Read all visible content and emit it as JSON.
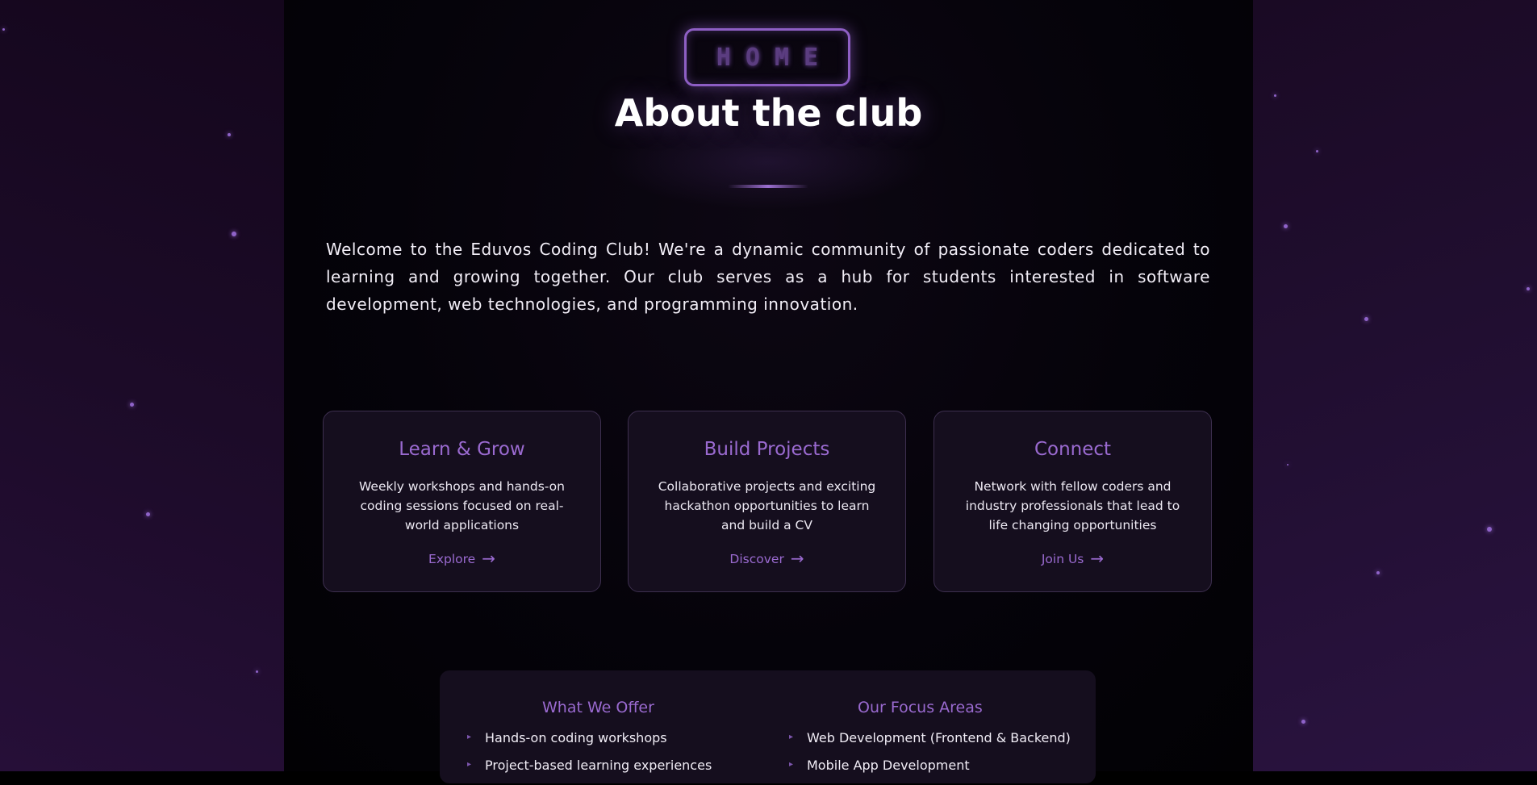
{
  "badge": {
    "text": "HOME"
  },
  "header": {
    "title": "About the club"
  },
  "intro": {
    "text": "Welcome to the Eduvos Coding Club! We're a dynamic community of passionate coders dedicated to learning and growing together. Our club serves as a hub for students interested in software development, web technologies, and programming innovation."
  },
  "cards": [
    {
      "title": "Learn & Grow",
      "text": "Weekly workshops and hands-on coding sessions focused on real-world applications",
      "link": "Explore",
      "arrow": "→"
    },
    {
      "title": "Build Projects",
      "text": "Collaborative projects and exciting hackathon opportunities to learn and build a CV",
      "link": "Discover",
      "arrow": "→"
    },
    {
      "title": "Connect",
      "text": "Network with fellow coders and industry professionals that lead to life changing opportunities",
      "link": "Join Us",
      "arrow": "→"
    }
  ],
  "offer": {
    "title": "What We Offer",
    "items": [
      "Hands-on coding workshops",
      "Project-based learning experiences"
    ]
  },
  "focus": {
    "title": "Our Focus Areas",
    "items": [
      "Web Development (Frontend & Backend)",
      "Mobile App Development"
    ]
  },
  "bullet_glyph": "▸",
  "colors": {
    "accent": "#9a6ad0",
    "card_bg": "#150e1e",
    "background": "#020104"
  },
  "icons": {
    "link_arrow": "arrow-right-icon",
    "list_bullet": "triangle-bullet-icon"
  }
}
